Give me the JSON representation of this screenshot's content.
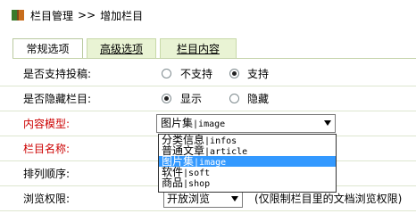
{
  "breadcrumb": {
    "root": "栏目管理",
    "sep": ">>",
    "current": "增加栏目"
  },
  "tabs": [
    {
      "label": "常规选项"
    },
    {
      "label": "高级选项"
    },
    {
      "label": "栏目内容"
    }
  ],
  "rows": {
    "submit": {
      "label": "是否支持投稿:",
      "options": [
        "不支持",
        "支持"
      ],
      "selected": "支持"
    },
    "hidden": {
      "label": "是否隐藏栏目:",
      "options": [
        "显示",
        "隐藏"
      ],
      "selected": "显示"
    },
    "model": {
      "label": "内容模型:",
      "value_cn": "图片集",
      "value_en": "image"
    },
    "name": {
      "label": "栏目名称:"
    },
    "order": {
      "label": "排列顺序:"
    },
    "browse": {
      "label": "浏览权限:",
      "value": "开放浏览",
      "note": "(仅限制栏目里的文档浏览权限)"
    }
  },
  "model_options": [
    {
      "cn": "分类信息",
      "en": "infos"
    },
    {
      "cn": "普通文章",
      "en": "article"
    },
    {
      "cn": "图片集",
      "en": "image",
      "selected": true
    },
    {
      "cn": "软件",
      "en": "soft"
    },
    {
      "cn": "商品",
      "en": "shop"
    }
  ]
}
